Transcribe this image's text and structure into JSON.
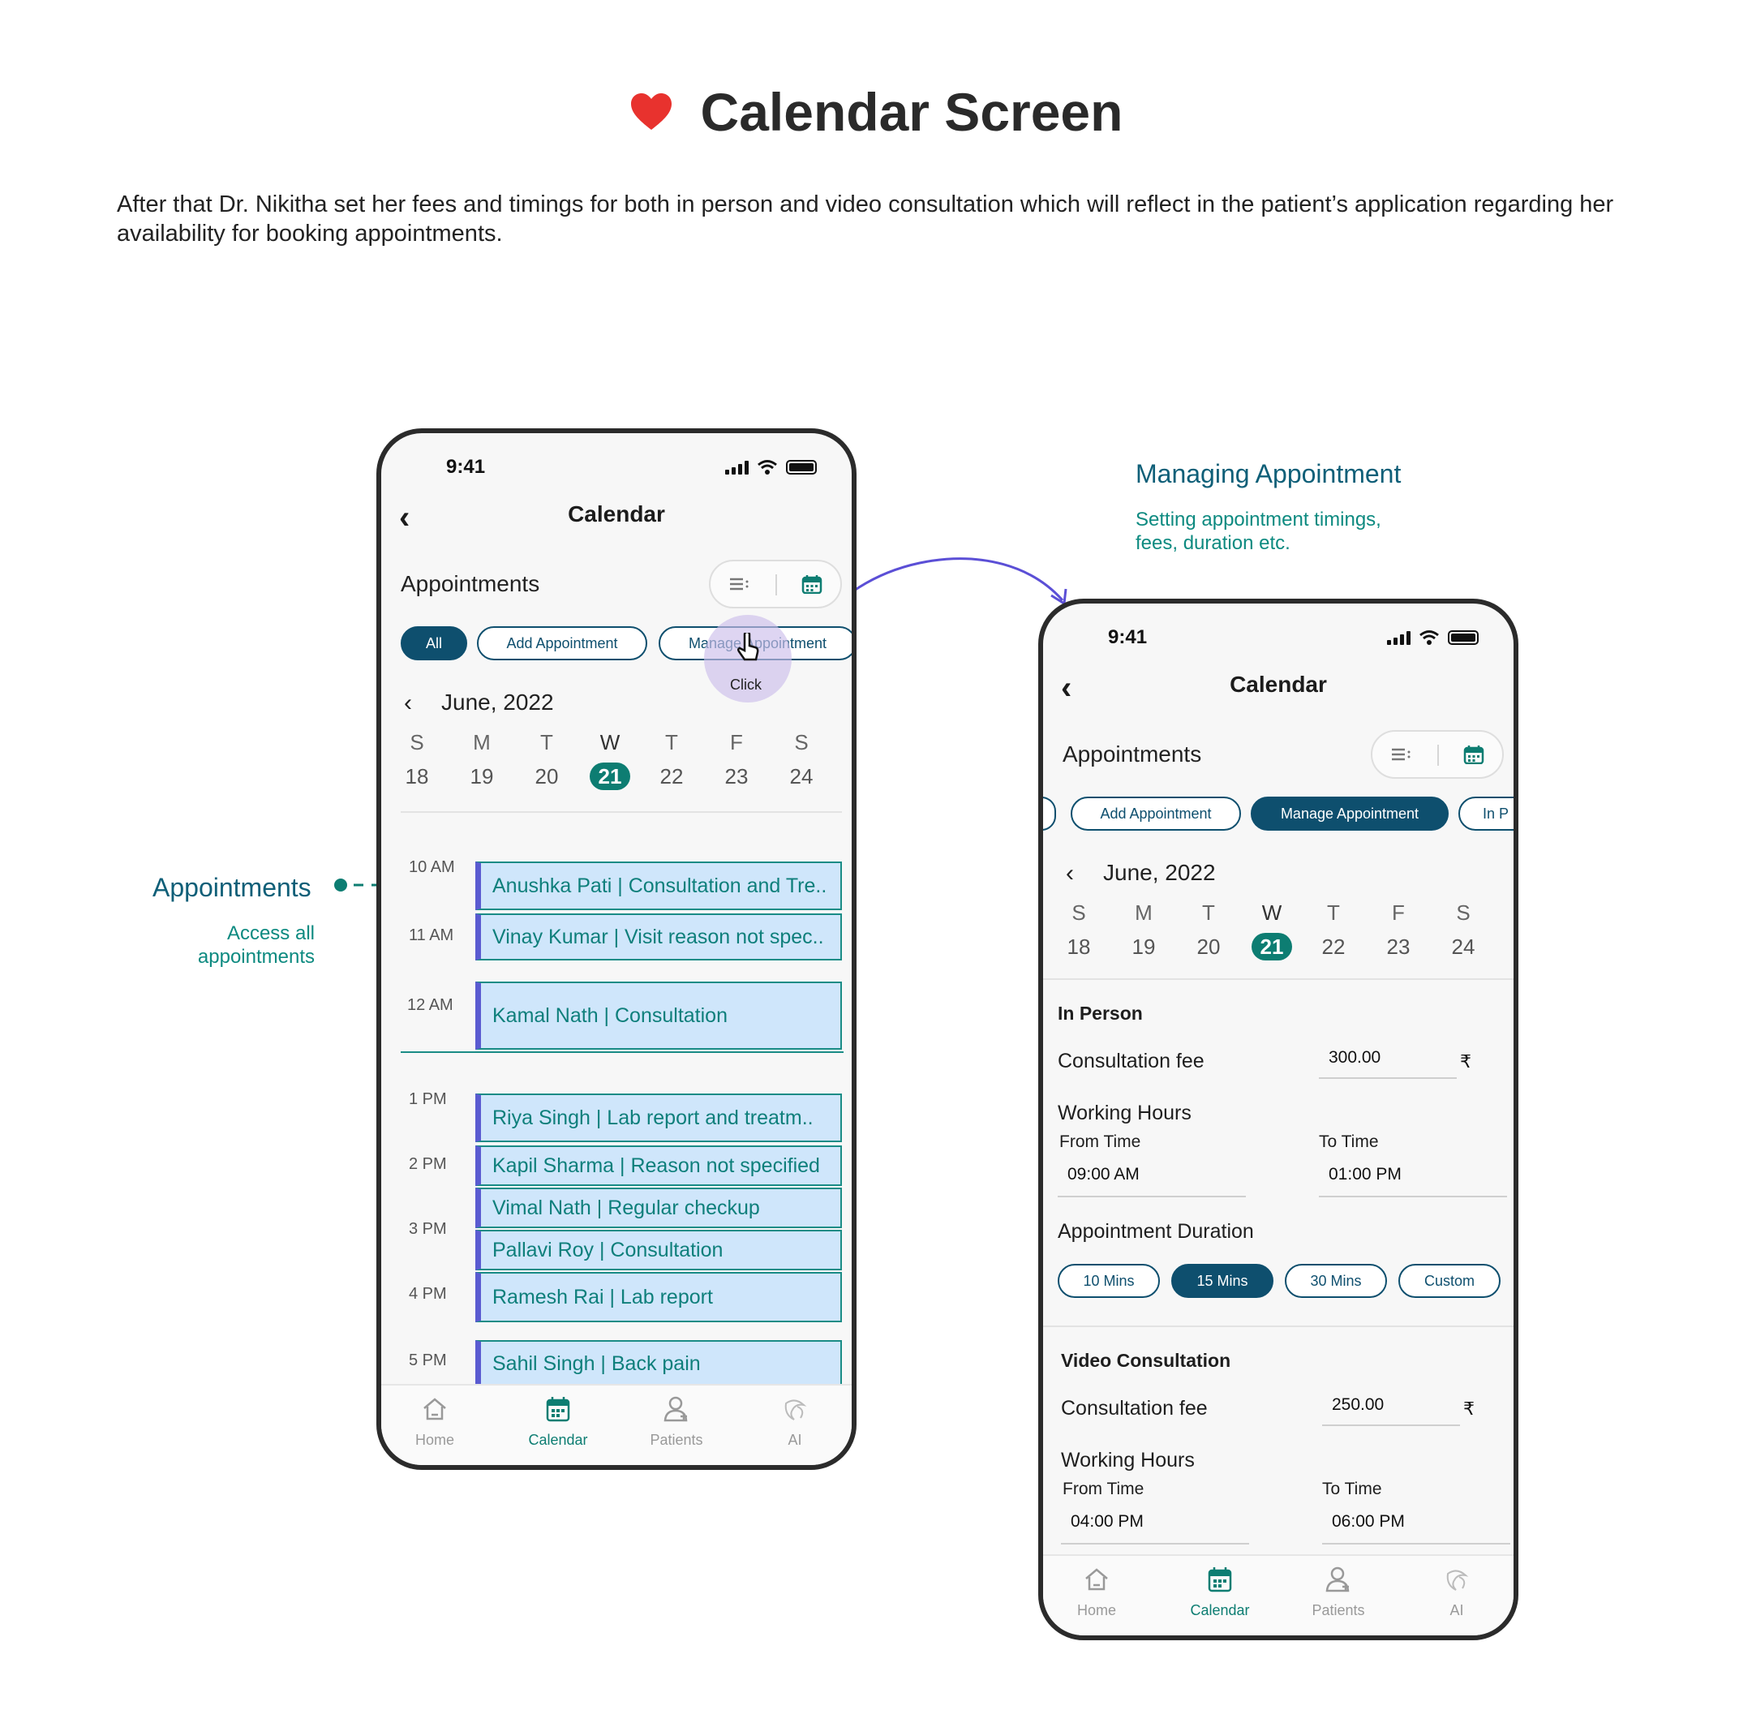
{
  "header": {
    "title": "Calendar Screen",
    "description": "After that Dr. Nikitha set her fees and timings for both in person and video consultation which will reflect in the patient’s application regarding her availability for booking appointments."
  },
  "annotations": {
    "left": {
      "title": "Appointments",
      "subtitle_line1": "Access all",
      "subtitle_line2": "appointments"
    },
    "right": {
      "title": "Managing Appointment",
      "subtitle_line1": "Setting appointment timings,",
      "subtitle_line2": "fees, duration etc."
    }
  },
  "colors": {
    "accent": "#0e4f6e",
    "teal": "#0d7d72",
    "appointment_bg": "#cfe6fb",
    "appointment_border": "#5a5bd1",
    "heart": "#e8322e"
  },
  "phone1": {
    "status_time": "9:41",
    "nav_title": "Calendar",
    "section_title": "Appointments",
    "chips": [
      "All",
      "Add Appointment",
      "Manage Appointment"
    ],
    "selected_chip": "All",
    "click_label": "Click",
    "month": "June, 2022",
    "weekdays": [
      "S",
      "M",
      "T",
      "W",
      "T",
      "F",
      "S"
    ],
    "dates": [
      "18",
      "19",
      "20",
      "21",
      "22",
      "23",
      "24"
    ],
    "selected_date": "21",
    "hours": [
      "10 AM",
      "11 AM",
      "12 AM",
      "1 PM",
      "2 PM",
      "3 PM",
      "4 PM",
      "5 PM"
    ],
    "appointments": [
      "Anushka Pati | Consultation and Tre..",
      "Vinay Kumar | Visit reason not spec..",
      "Kamal Nath | Consultation",
      "Riya Singh | Lab report and treatm..",
      "Kapil Sharma | Reason not specified",
      "Vimal Nath | Regular checkup",
      "Pallavi Roy | Consultation",
      "Ramesh Rai | Lab report",
      "Sahil Singh | Back pain"
    ],
    "tabs": [
      "Home",
      "Calendar",
      "Patients",
      "AI"
    ],
    "active_tab": "Calendar"
  },
  "phone2": {
    "status_time": "9:41",
    "nav_title": "Calendar",
    "section_title": "Appointments",
    "chips": [
      "Add Appointment",
      "Manage Appointment",
      "In P"
    ],
    "selected_chip": "Manage Appointment",
    "month": "June, 2022",
    "weekdays": [
      "S",
      "M",
      "T",
      "W",
      "T",
      "F",
      "S"
    ],
    "dates": [
      "18",
      "19",
      "20",
      "21",
      "22",
      "23",
      "24"
    ],
    "selected_date": "21",
    "in_person": {
      "heading": "In Person",
      "fee_label": "Consultation fee",
      "fee_value": "300.00",
      "currency": "₹",
      "working_hours_label": "Working Hours",
      "from_label": "From Time",
      "to_label": "To Time",
      "from_value": "09:00 AM",
      "to_value": "01:00 PM",
      "duration_label": "Appointment Duration",
      "durations": [
        "10 Mins",
        "15 Mins",
        "30 Mins",
        "Custom"
      ],
      "selected_duration": "15 Mins"
    },
    "video": {
      "heading": "Video Consultation",
      "fee_label": "Consultation fee",
      "fee_value": "250.00",
      "currency": "₹",
      "working_hours_label": "Working Hours",
      "from_label": "From Time",
      "to_label": "To Time",
      "from_value": "04:00 PM",
      "to_value": "06:00 PM"
    },
    "tabs": [
      "Home",
      "Calendar",
      "Patients",
      "AI"
    ],
    "active_tab": "Calendar"
  },
  "icons": [
    "heart-icon",
    "back-arrow-icon",
    "list-view-icon",
    "calendar-view-icon",
    "chevron-left-icon",
    "hand-pointer-icon",
    "home-icon",
    "calendar-icon",
    "patients-icon",
    "ai-icon",
    "signal-icon",
    "wifi-icon",
    "battery-icon"
  ]
}
